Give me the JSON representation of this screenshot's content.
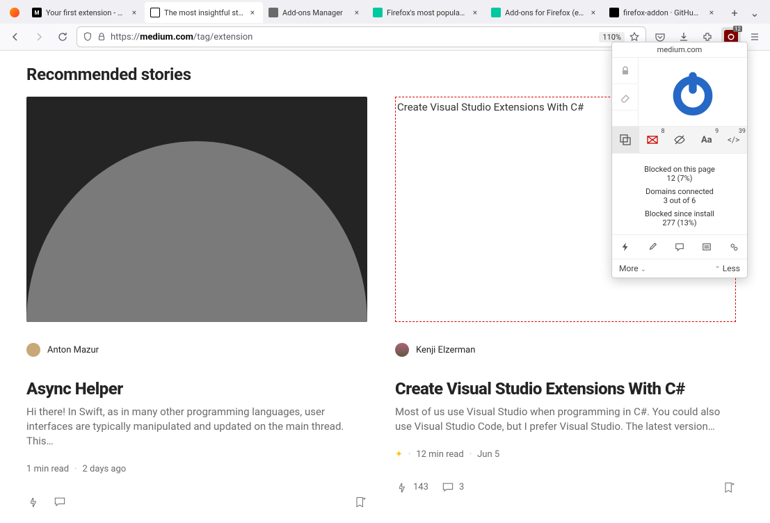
{
  "tabs": [
    {
      "title": "Your first extension - Mozilla | …"
    },
    {
      "title": "The most insightful stories abo…"
    },
    {
      "title": "Add-ons Manager"
    },
    {
      "title": "Firefox's most popular and inno…"
    },
    {
      "title": "Add-ons for Firefox (en-US)"
    },
    {
      "title": "firefox-addon · GitHub Topics …"
    }
  ],
  "toolbar": {
    "url_prefix": "https://",
    "url_host": "medium.com",
    "url_path": "/tag/extension",
    "zoom": "110%"
  },
  "page": {
    "section_title": "Recommended stories",
    "story1": {
      "author": "Anton Mazur",
      "title": "Async Helper",
      "excerpt": "Hi there! In Swift, as in many other programming languages, user interfaces are typically manipulated and updated on the main thread. This…",
      "read_time": "1 min read",
      "date": "2 days ago"
    },
    "story2": {
      "blocked_text": "Create Visual Studio Extensions With C#",
      "author": "Kenji Elzerman",
      "title": "Create Visual Studio Extensions With C#",
      "excerpt": "Most of us use Visual Studio when programming in C#. You could also use Visual Studio Code, but I prefer Visual Studio. The latest version…",
      "read_time": "12 min read",
      "date": "Jun 5",
      "claps": "143",
      "comments": "3"
    }
  },
  "ublock": {
    "domain": "medium.com",
    "popup_sup": "8",
    "font_sup": "9",
    "script_sup": "39",
    "stat_blocked_label": "Blocked on this page",
    "stat_blocked_val": "12 (7%)",
    "stat_domains_label": "Domains connected",
    "stat_domains_val": "3 out of 6",
    "stat_install_label": "Blocked since install",
    "stat_install_val": "277 (13%)",
    "more": "More",
    "less": "Less",
    "badge": "12"
  }
}
